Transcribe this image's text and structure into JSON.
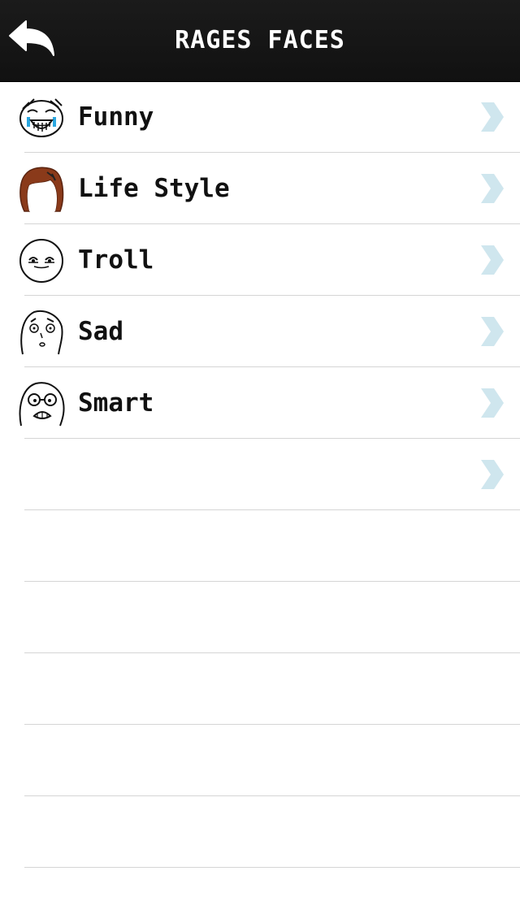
{
  "header": {
    "title": "RAGES FACES",
    "back_icon": "back-arrow-icon"
  },
  "rows": [
    {
      "label": "Funny",
      "icon": "funny-face-icon"
    },
    {
      "label": "Life Style",
      "icon": "life-style-face-icon"
    },
    {
      "label": "Troll",
      "icon": "troll-face-icon"
    },
    {
      "label": "Sad",
      "icon": "sad-face-icon"
    },
    {
      "label": "Smart",
      "icon": "smart-face-icon"
    },
    {
      "label": "",
      "icon": ""
    }
  ],
  "colors": {
    "header_bg": "#141414",
    "chevron": "#cfe6ee",
    "separator": "#d5d5d5",
    "hair": "#8a3a1a",
    "tears": "#2aa7e0"
  }
}
